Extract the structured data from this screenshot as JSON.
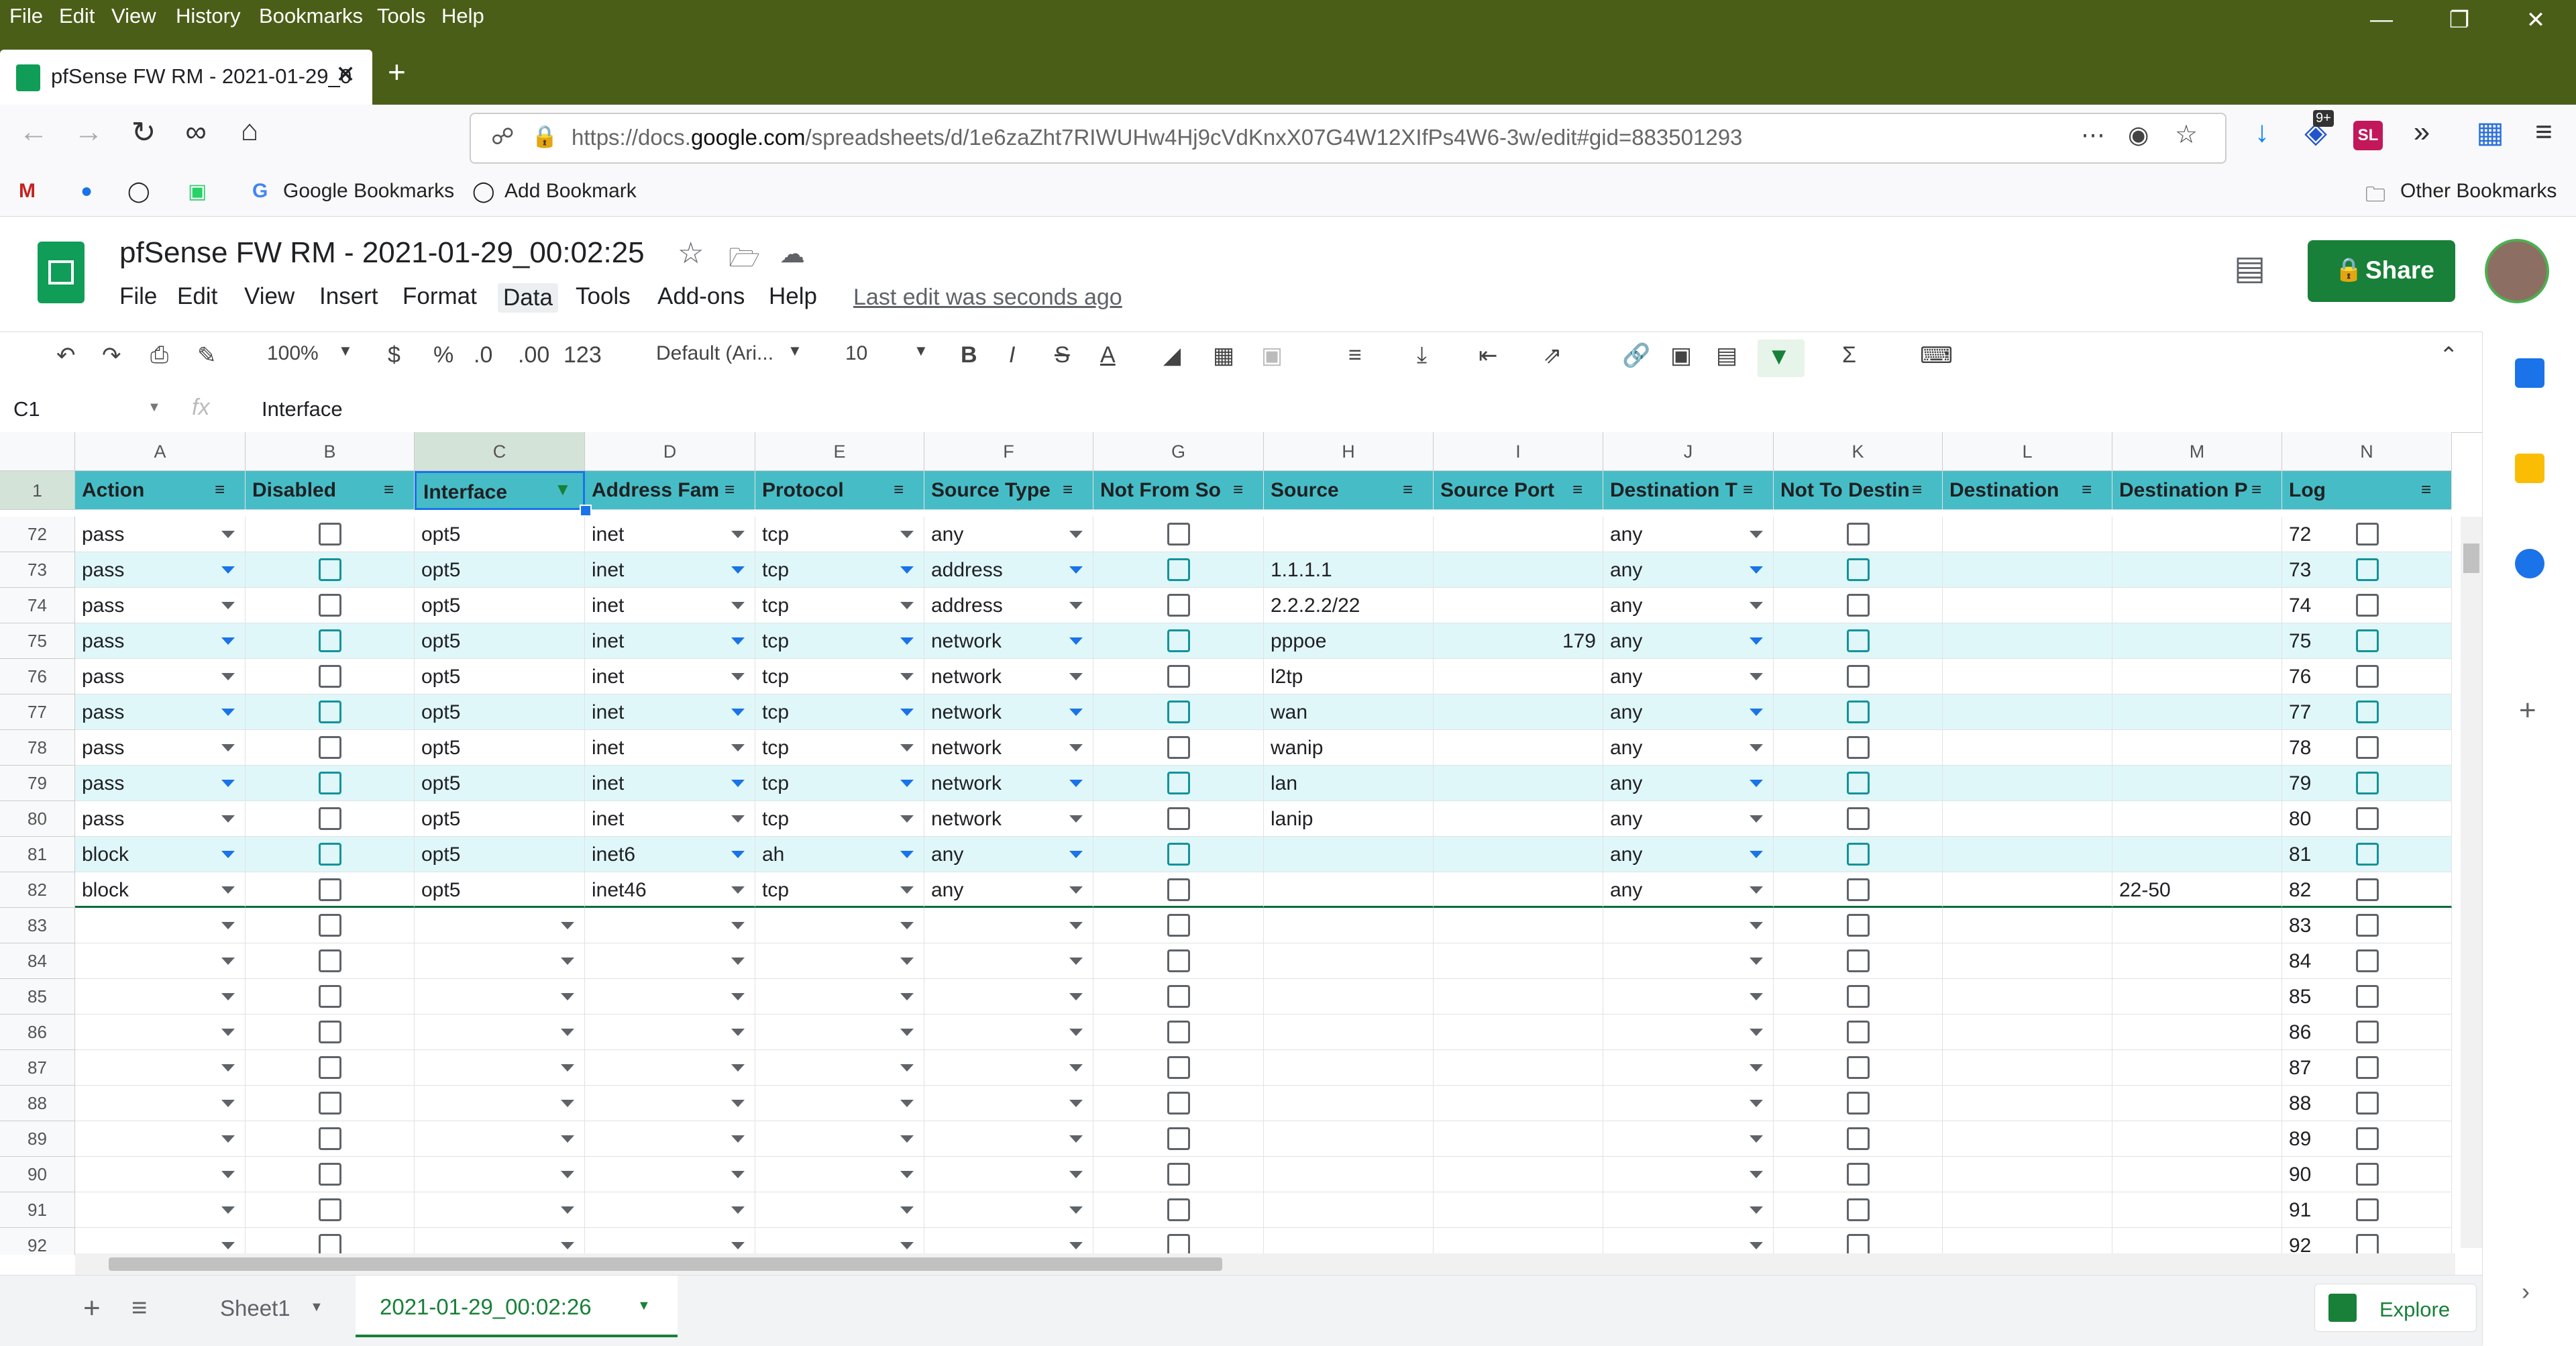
{
  "browser": {
    "menu": [
      "File",
      "Edit",
      "View",
      "History",
      "Bookmarks",
      "Tools",
      "Help"
    ],
    "tab_title": "pfSense FW RM - 2021-01-29_0",
    "url_prefix": "https://docs.",
    "url_domain": "google.com",
    "url_rest": "/spreadsheets/d/1e6zaZht7RIWUHw4Hj9cVdKnxX07G4W12XIfPs4W6-3w/edit#gid=883501293",
    "badge": "9+",
    "bookmarks": [
      "Google Bookmarks",
      "Add Bookmark"
    ],
    "other_bookmarks": "Other Bookmarks"
  },
  "doc": {
    "title": "pfSense FW RM - 2021-01-29_00:02:25",
    "menu": [
      "File",
      "Edit",
      "View",
      "Insert",
      "Format",
      "Data",
      "Tools",
      "Add-ons",
      "Help"
    ],
    "last_edit": "Last edit was seconds ago",
    "share": "Share"
  },
  "toolbar": {
    "zoom": "100%",
    "currency": "$",
    "percent": "%",
    "dec_less": ".0",
    "dec_more": ".00",
    "format_more": "123",
    "font": "Default (Ari...",
    "font_size": "10"
  },
  "formula_bar": {
    "cell_ref": "C1",
    "fx": "fx",
    "value": "Interface"
  },
  "grid": {
    "columns": [
      "A",
      "B",
      "C",
      "D",
      "E",
      "F",
      "G",
      "H",
      "I",
      "J",
      "K",
      "L",
      "M",
      "N"
    ],
    "header_row_number": "1",
    "headers": [
      "Action",
      "Disabled",
      "Interface",
      "Address Fam",
      "Protocol",
      "Source Type",
      "Not From So",
      "Source",
      "Source Port",
      "Destination T",
      "Not To Destin",
      "Destination",
      "Destination P",
      "Log"
    ],
    "rows": [
      {
        "n": "72",
        "a": "pass",
        "c": "opt5",
        "d": "inet",
        "e": "tcp",
        "f": "any",
        "h": "",
        "i": "",
        "j": "any",
        "m": ""
      },
      {
        "n": "73",
        "a": "pass",
        "c": "opt5",
        "d": "inet",
        "e": "tcp",
        "f": "address",
        "h": "1.1.1.1",
        "i": "",
        "j": "any",
        "m": ""
      },
      {
        "n": "74",
        "a": "pass",
        "c": "opt5",
        "d": "inet",
        "e": "tcp",
        "f": "address",
        "h": "2.2.2.2/22",
        "i": "",
        "j": "any",
        "m": ""
      },
      {
        "n": "75",
        "a": "pass",
        "c": "opt5",
        "d": "inet",
        "e": "tcp",
        "f": "network",
        "h": "pppoe",
        "i": "179",
        "j": "any",
        "m": ""
      },
      {
        "n": "76",
        "a": "pass",
        "c": "opt5",
        "d": "inet",
        "e": "tcp",
        "f": "network",
        "h": "l2tp",
        "i": "",
        "j": "any",
        "m": ""
      },
      {
        "n": "77",
        "a": "pass",
        "c": "opt5",
        "d": "inet",
        "e": "tcp",
        "f": "network",
        "h": "wan",
        "i": "",
        "j": "any",
        "m": ""
      },
      {
        "n": "78",
        "a": "pass",
        "c": "opt5",
        "d": "inet",
        "e": "tcp",
        "f": "network",
        "h": "wanip",
        "i": "",
        "j": "any",
        "m": ""
      },
      {
        "n": "79",
        "a": "pass",
        "c": "opt5",
        "d": "inet",
        "e": "tcp",
        "f": "network",
        "h": "lan",
        "i": "",
        "j": "any",
        "m": ""
      },
      {
        "n": "80",
        "a": "pass",
        "c": "opt5",
        "d": "inet",
        "e": "tcp",
        "f": "network",
        "h": "lanip",
        "i": "",
        "j": "any",
        "m": ""
      },
      {
        "n": "81",
        "a": "block",
        "c": "opt5",
        "d": "inet6",
        "e": "ah",
        "f": "any",
        "h": "",
        "i": "",
        "j": "any",
        "m": ""
      },
      {
        "n": "82",
        "a": "block",
        "c": "opt5",
        "d": "inet46",
        "e": "tcp",
        "f": "any",
        "h": "",
        "i": "",
        "j": "any",
        "m": "22-50"
      },
      {
        "n": "83",
        "a": "",
        "c": "",
        "d": "",
        "e": "",
        "f": "",
        "h": "",
        "i": "",
        "j": "",
        "m": ""
      },
      {
        "n": "84",
        "a": "",
        "c": "",
        "d": "",
        "e": "",
        "f": "",
        "h": "",
        "i": "",
        "j": "",
        "m": ""
      },
      {
        "n": "85",
        "a": "",
        "c": "",
        "d": "",
        "e": "",
        "f": "",
        "h": "",
        "i": "",
        "j": "",
        "m": ""
      },
      {
        "n": "86",
        "a": "",
        "c": "",
        "d": "",
        "e": "",
        "f": "",
        "h": "",
        "i": "",
        "j": "",
        "m": ""
      },
      {
        "n": "87",
        "a": "",
        "c": "",
        "d": "",
        "e": "",
        "f": "",
        "h": "",
        "i": "",
        "j": "",
        "m": ""
      },
      {
        "n": "88",
        "a": "",
        "c": "",
        "d": "",
        "e": "",
        "f": "",
        "h": "",
        "i": "",
        "j": "",
        "m": ""
      },
      {
        "n": "89",
        "a": "",
        "c": "",
        "d": "",
        "e": "",
        "f": "",
        "h": "",
        "i": "",
        "j": "",
        "m": ""
      },
      {
        "n": "90",
        "a": "",
        "c": "",
        "d": "",
        "e": "",
        "f": "",
        "h": "",
        "i": "",
        "j": "",
        "m": ""
      },
      {
        "n": "91",
        "a": "",
        "c": "",
        "d": "",
        "e": "",
        "f": "",
        "h": "",
        "i": "",
        "j": "",
        "m": ""
      },
      {
        "n": "92",
        "a": "",
        "c": "",
        "d": "",
        "e": "",
        "f": "",
        "h": "",
        "i": "",
        "j": "",
        "m": ""
      }
    ]
  },
  "sheets": {
    "tabs": [
      "Sheet1",
      "2021-01-29_00:02:26"
    ],
    "explore": "Explore"
  },
  "colors": {
    "header_fill": "#46bdc6",
    "band_fill": "#e0f7fa",
    "share_green": "#188038",
    "titlebar": "#4b5e18"
  }
}
